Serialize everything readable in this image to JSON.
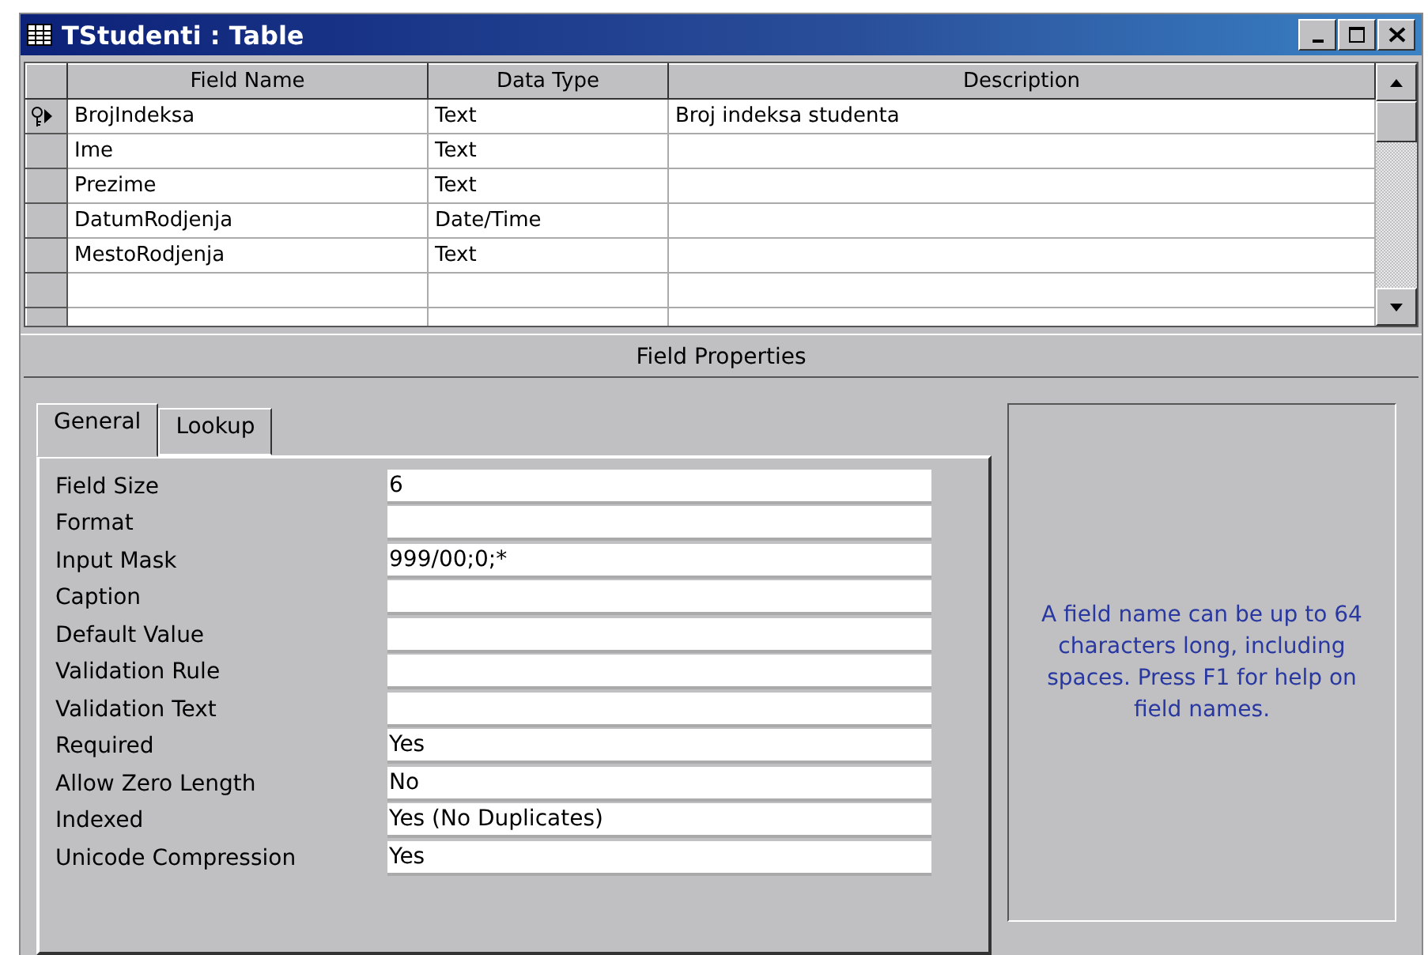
{
  "window": {
    "title": "TStudenti : Table"
  },
  "grid": {
    "columns": [
      "Field Name",
      "Data Type",
      "Description"
    ],
    "rows": [
      {
        "field_name": "BrojIndeksa",
        "data_type": "Text",
        "description": "Broj indeksa studenta",
        "primary_key": true,
        "current": true
      },
      {
        "field_name": "Ime",
        "data_type": "Text",
        "primary_key": false,
        "current": false
      },
      {
        "field_name": "Prezime",
        "data_type": "Text",
        "primary_key": false,
        "current": false
      },
      {
        "field_name": "DatumRodjenja",
        "data_type": "Date/Time",
        "primary_key": false,
        "current": false
      },
      {
        "field_name": "MestoRodjenja",
        "data_type": "Text",
        "primary_key": false,
        "current": false
      }
    ]
  },
  "field_properties": {
    "title": "Field Properties",
    "tabs": [
      {
        "label": "General",
        "selected": true
      },
      {
        "label": "Lookup",
        "selected": false
      }
    ],
    "properties": [
      {
        "label": "Field Size",
        "value": "6"
      },
      {
        "label": "Format"
      },
      {
        "label": "Input Mask",
        "value": "999/00;0;*"
      },
      {
        "label": "Caption"
      },
      {
        "label": "Default Value"
      },
      {
        "label": "Validation Rule"
      },
      {
        "label": "Validation Text"
      },
      {
        "label": "Required",
        "value": "Yes"
      },
      {
        "label": "Allow Zero Length",
        "value": "No"
      },
      {
        "label": "Indexed",
        "value": "Yes (No Duplicates)"
      },
      {
        "label": "Unicode Compression",
        "value": "Yes"
      }
    ],
    "help": "A field name can be up to 64 characters long, including spaces.  Press F1 for help on field names."
  }
}
